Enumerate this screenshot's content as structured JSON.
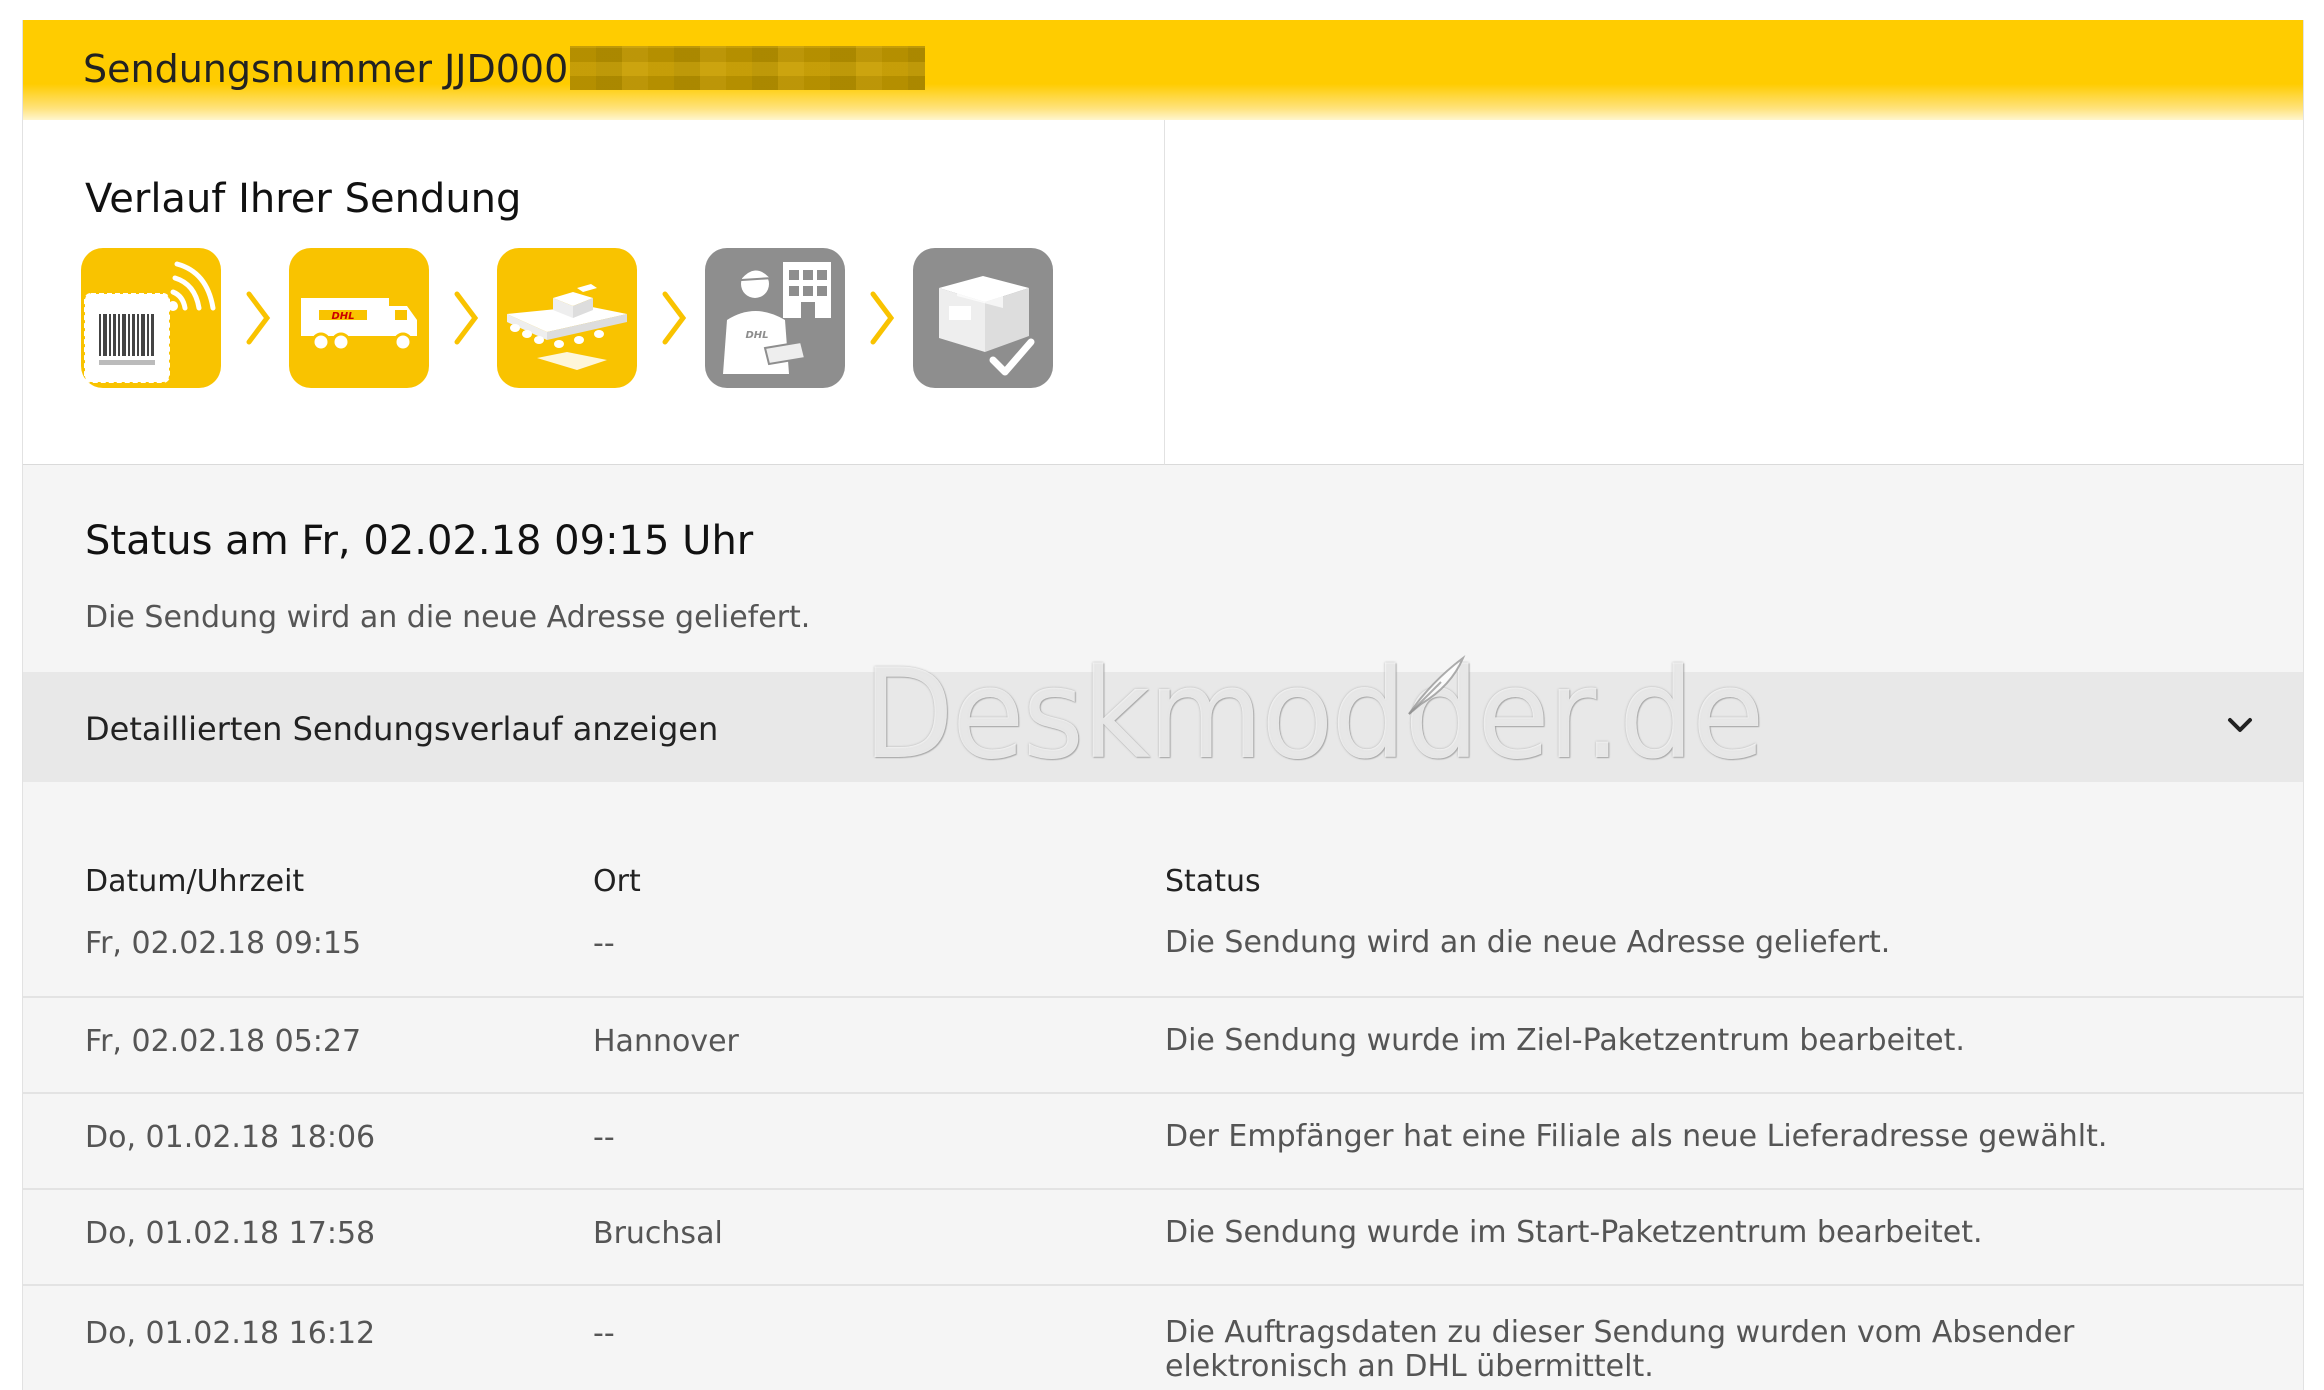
{
  "header": {
    "title": "Sendungsnummer JJD000"
  },
  "progress": {
    "title": "Verlauf Ihrer Sendung",
    "steps": [
      {
        "icon": "barcode-label-icon",
        "state": "done"
      },
      {
        "icon": "dhl-truck-icon",
        "state": "done"
      },
      {
        "icon": "conveyor-belt-icon",
        "state": "done"
      },
      {
        "icon": "courier-delivery-icon",
        "state": "pending"
      },
      {
        "icon": "package-delivered-icon",
        "state": "pending"
      }
    ],
    "colors": {
      "active": "#f9c300",
      "inactive": "#8e8e8e",
      "chevron": "#f9c300"
    }
  },
  "status": {
    "title": "Status am Fr, 02.02.18 09:15 Uhr",
    "text": "Die Sendung wird an die neue Adresse geliefert."
  },
  "toggle": {
    "label": "Detaillierten Sendungsverlauf anzeigen"
  },
  "watermark": {
    "text": "Deskmodder.de"
  },
  "history": {
    "headers": {
      "date": "Datum/Uhrzeit",
      "place": "Ort",
      "status": "Status"
    },
    "rows": [
      {
        "date": "Fr, 02.02.18 09:15",
        "place": "--",
        "status": "Die Sendung wird an die neue Adresse geliefert."
      },
      {
        "date": "Fr, 02.02.18 05:27",
        "place": "Hannover",
        "status": "Die Sendung wurde im Ziel-Paketzentrum bearbeitet."
      },
      {
        "date": "Do, 01.02.18 18:06",
        "place": "--",
        "status": "Der Empfänger hat eine Filiale als neue Lieferadresse gewählt."
      },
      {
        "date": "Do, 01.02.18 17:58",
        "place": "Bruchsal",
        "status": "Die Sendung wurde im Start-Paketzentrum bearbeitet."
      },
      {
        "date": "Do, 01.02.18 16:12",
        "place": "--",
        "status": "Die Auftragsdaten zu dieser Sendung wurden vom Absender elektronisch an DHL übermittelt."
      }
    ]
  }
}
